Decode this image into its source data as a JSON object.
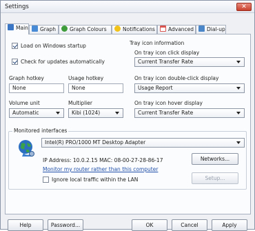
{
  "window": {
    "title": "Settings",
    "close_label": "✕"
  },
  "tabs": [
    {
      "label": "Main",
      "color": "#3a76c4"
    },
    {
      "label": "Graph",
      "color": "#4a8bd6"
    },
    {
      "label": "Graph Colours",
      "color": "#3f9c3a"
    },
    {
      "label": "Notifications",
      "color": "#f1c21a"
    },
    {
      "label": "Advanced",
      "color": "#d9534f"
    },
    {
      "label": "Dial-up",
      "color": "#4a86c8"
    }
  ],
  "main": {
    "load_on_startup": {
      "label": "Load on Windows startup",
      "checked": true
    },
    "check_updates": {
      "label": "Check for updates automatically",
      "checked": true
    },
    "graph_hotkey": {
      "label": "Graph hotkey",
      "value": "None"
    },
    "usage_hotkey": {
      "label": "Usage hotkey",
      "value": "None"
    },
    "volume_unit": {
      "label": "Volume unit",
      "value": "Automatic"
    },
    "multiplier": {
      "label": "Multiplier",
      "value": "Kibi (1024)"
    }
  },
  "tray": {
    "group_label": "Tray icon information",
    "click": {
      "label": "On tray icon click display",
      "value": "Current Transfer Rate"
    },
    "double_click": {
      "label": "On tray icon double-click display",
      "value": "Usage Report"
    },
    "hover": {
      "label": "On tray icon hover display",
      "value": "Current Transfer Rate"
    }
  },
  "interfaces": {
    "group_label": "Monitored interfaces",
    "adapter": "Intel(R) PRO/1000 MT Desktop Adapter",
    "ip_info": "IP Address: 10.0.2.15   MAC: 08-00-27-28-86-17",
    "monitor_link": "Monitor my router rather than this computer",
    "ignore_local": {
      "label": "Ignore local traffic within the LAN",
      "checked": false
    },
    "networks_button": "Networks...",
    "setup_button": "Setup..."
  },
  "footer": {
    "help": "Help",
    "password": "Password...",
    "ok": "OK",
    "cancel": "Cancel",
    "apply": "Apply"
  }
}
